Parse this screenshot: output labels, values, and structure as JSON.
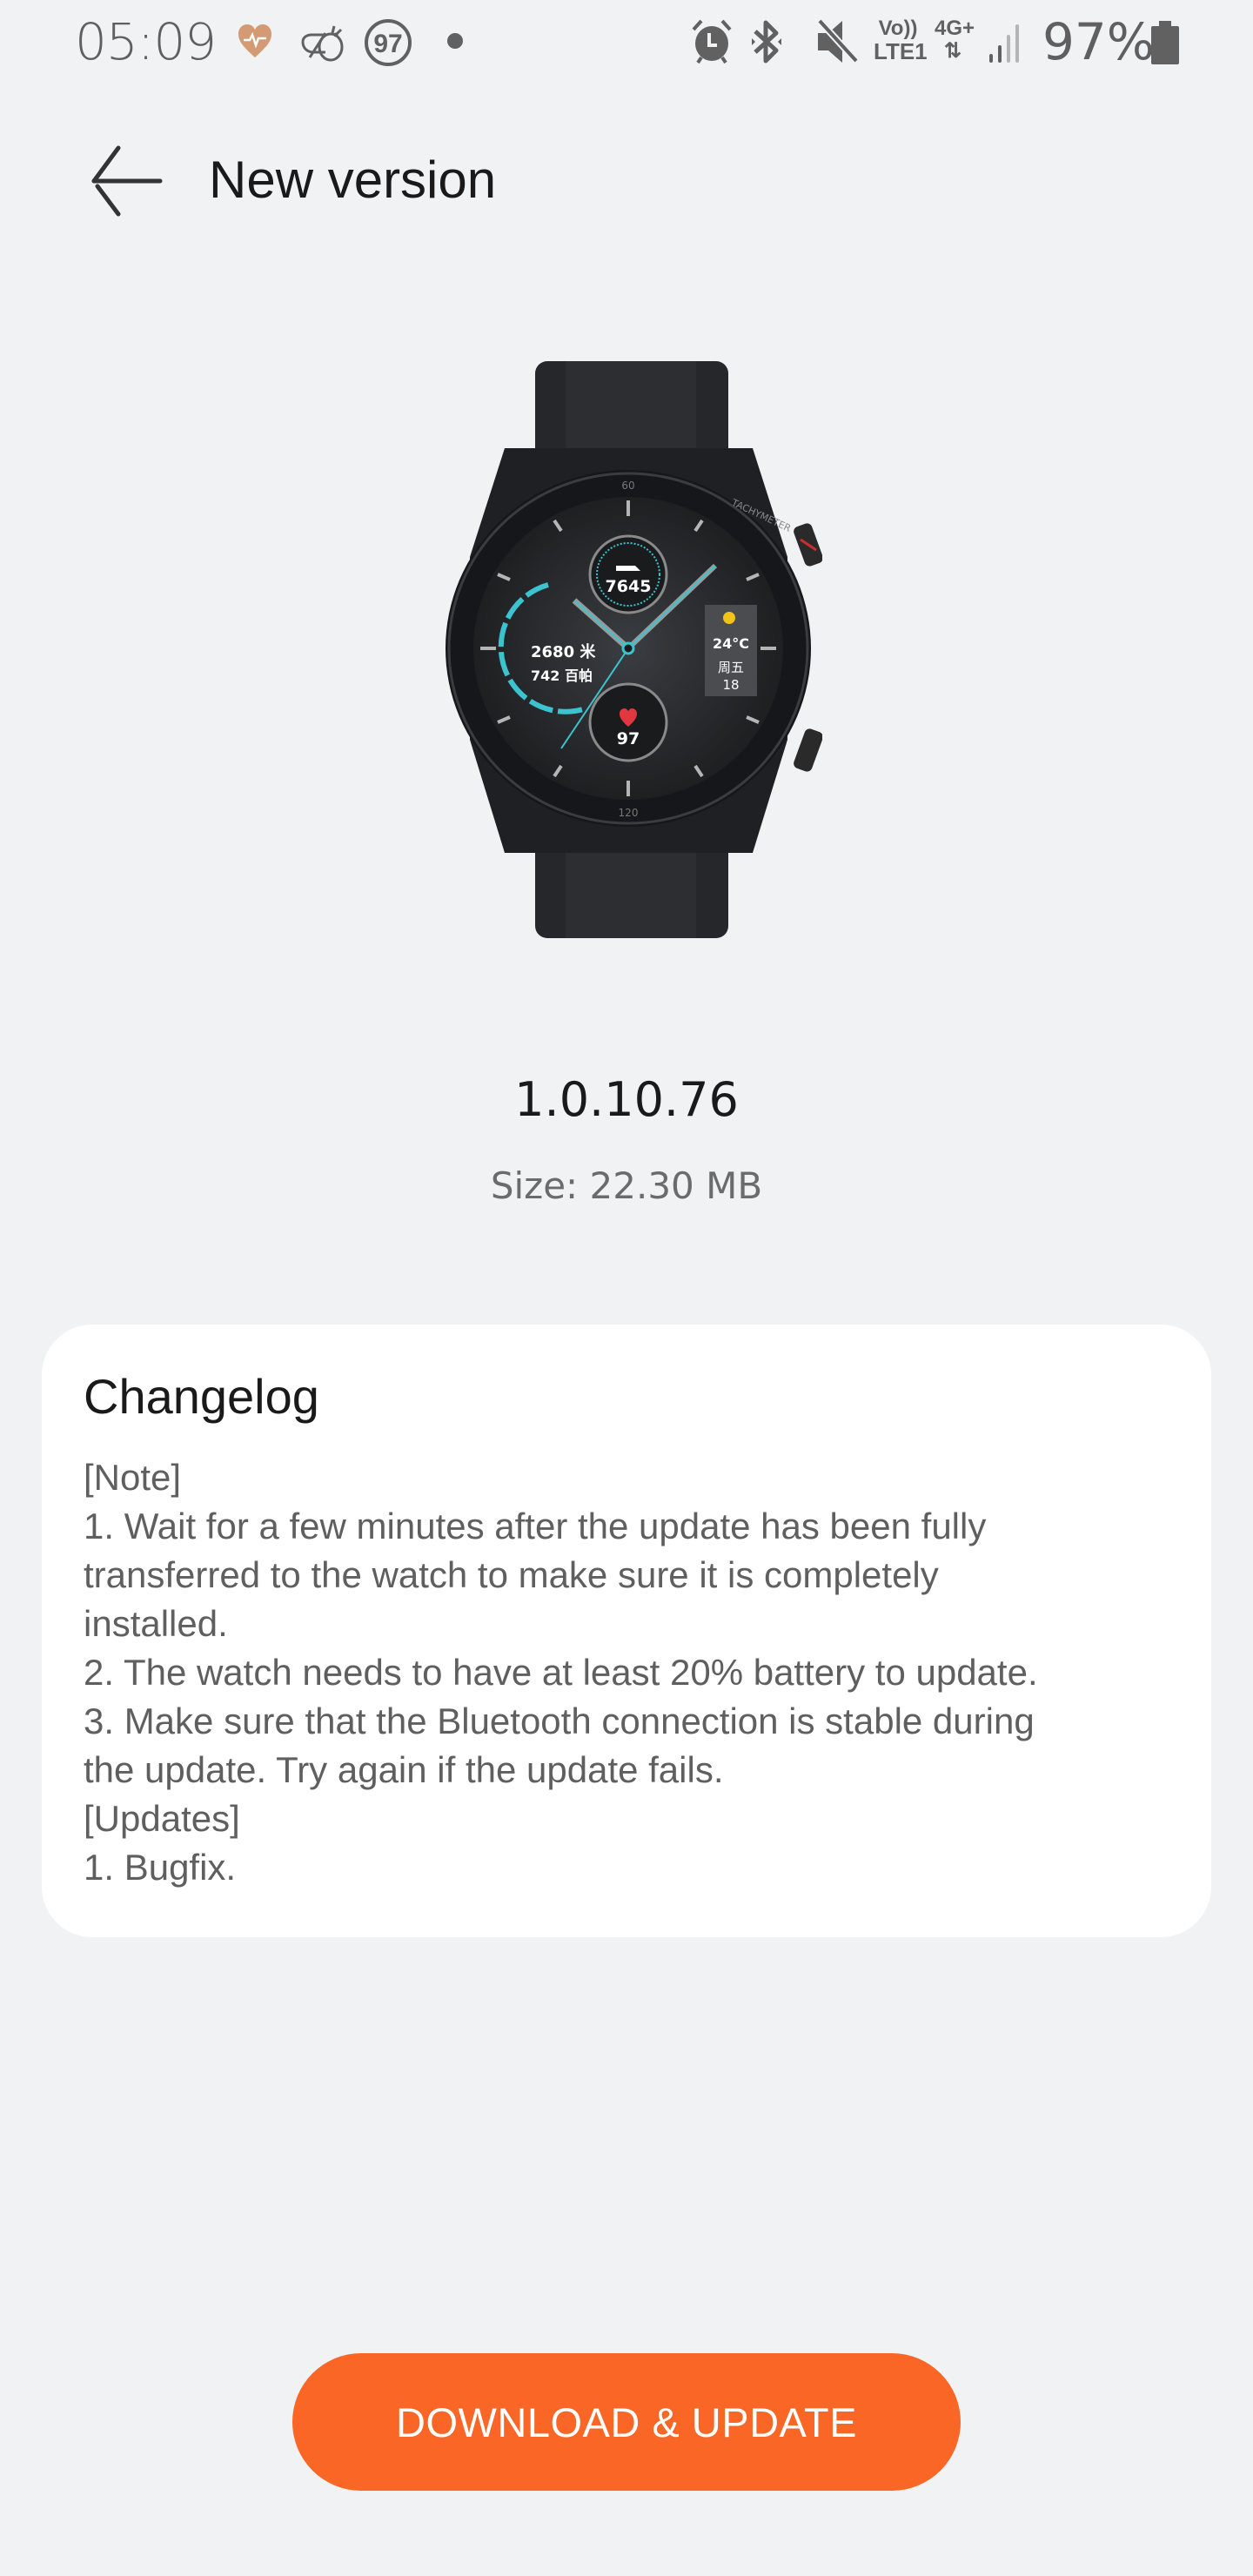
{
  "status_bar": {
    "time": "05:09",
    "left_icons": [
      "health-heart-icon",
      "bee-app-icon",
      "badge-97-icon",
      "notification-dot-icon"
    ],
    "badge_value": "97",
    "right_icons": [
      "alarm-icon",
      "bluetooth-icon",
      "mute-icon",
      "volte-lte1-icon",
      "4g-plus-data-icon",
      "signal-icon",
      "battery-icon"
    ],
    "volte_label_top": "Vo))",
    "volte_label_bottom": "LTE1",
    "network_label": "4G+",
    "battery_percent": "97%",
    "heart_color": "#d39a74"
  },
  "app_bar": {
    "back_icon": "arrow-left-icon",
    "title": "New version"
  },
  "product": {
    "image": "smartwatch-image",
    "watch_face": {
      "steps": "7645",
      "altitude": "2680 米",
      "pressure": "742 百帕",
      "temperature": "24°C",
      "weekday": "周五",
      "date": "18",
      "heart_rate": "97",
      "bezel_label": "TACHYMETER"
    }
  },
  "firmware": {
    "version": "1.0.10.76",
    "size": "Size: 22.30 MB"
  },
  "changelog": {
    "title": "Changelog",
    "lines": [
      "[Note]",
      "1. Wait for a few minutes after the update has been fully",
      "transferred to the watch to make sure it is completely",
      "installed.",
      "2. The watch needs to have at least 20% battery to update.",
      "3. Make sure that the Bluetooth connection is stable during",
      "the update. Try again if the update fails.",
      "[Updates]",
      "1. Bugfix."
    ]
  },
  "actions": {
    "download_update_label": "DOWNLOAD & UPDATE",
    "accent_color": "#f96625"
  }
}
